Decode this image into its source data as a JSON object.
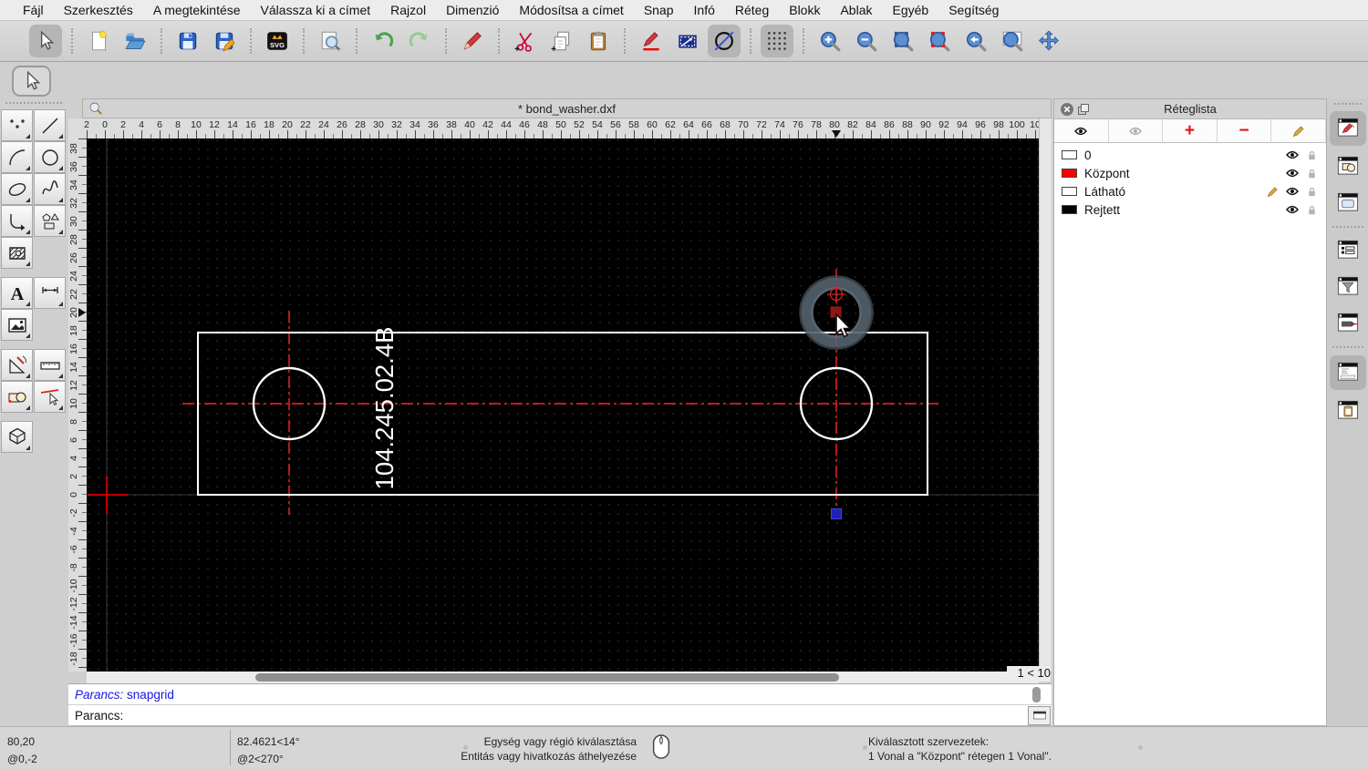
{
  "menu_bar": {
    "items": [
      "Fájl",
      "Szerkesztés",
      "A megtekintése",
      "Válassza ki a címet",
      "Rajzol",
      "Dimenzió",
      "Módosítsa a címet",
      "Snap",
      "Infó",
      "Réteg",
      "Blokk",
      "Ablak",
      "Egyéb",
      "Segítség"
    ]
  },
  "toolbar": {
    "buttons": [
      {
        "name": "select",
        "active": true
      },
      {
        "type": "sep"
      },
      {
        "name": "new-document"
      },
      {
        "name": "open-file"
      },
      {
        "type": "sep"
      },
      {
        "name": "save"
      },
      {
        "name": "save-as"
      },
      {
        "type": "sep"
      },
      {
        "name": "export-svg"
      },
      {
        "type": "sep"
      },
      {
        "name": "print-preview"
      },
      {
        "type": "sep"
      },
      {
        "name": "undo"
      },
      {
        "name": "redo"
      },
      {
        "type": "sep"
      },
      {
        "name": "delete"
      },
      {
        "type": "sep"
      },
      {
        "name": "cut"
      },
      {
        "name": "copy"
      },
      {
        "name": "paste"
      },
      {
        "type": "sep"
      },
      {
        "name": "draw-pen"
      },
      {
        "name": "selection-window"
      },
      {
        "name": "circle-line",
        "active": true
      },
      {
        "type": "sep"
      },
      {
        "name": "snap-grid",
        "active": true
      },
      {
        "type": "sep"
      },
      {
        "name": "zoom-in"
      },
      {
        "name": "zoom-out"
      },
      {
        "name": "zoom-auto"
      },
      {
        "name": "zoom-redraw"
      },
      {
        "name": "zoom-previous"
      },
      {
        "name": "zoom-window"
      },
      {
        "name": "pan"
      }
    ]
  },
  "left_toolbar": {
    "groups": [
      [
        [
          "points",
          "line"
        ],
        [
          "arc",
          "circle"
        ],
        [
          "ellipse",
          "spline"
        ],
        [
          "polyline",
          "polygon"
        ],
        [
          "hatch",
          null
        ]
      ],
      [
        [
          "text",
          "dimension"
        ],
        [
          "image",
          null
        ]
      ],
      [
        [
          "modify",
          "measure"
        ],
        [
          "block",
          "deselect"
        ]
      ],
      [
        [
          "solid",
          null
        ]
      ]
    ]
  },
  "document_window": {
    "title": "* bond_washer.dxf",
    "zoom_indicator": "1 < 10",
    "drawing_label": "104.245.02.4B"
  },
  "rulers": {
    "horizontal": [
      "2",
      "0",
      "2",
      "4",
      "6",
      "8",
      "10",
      "12",
      "14",
      "16",
      "18",
      "20",
      "22",
      "24",
      "26",
      "28",
      "30",
      "32",
      "34",
      "36",
      "38",
      "40",
      "42",
      "44",
      "46",
      "48",
      "50",
      "52",
      "54",
      "56",
      "58",
      "60",
      "62",
      "64",
      "66",
      "68",
      "70",
      "72",
      "74",
      "76",
      "78",
      "80",
      "82",
      "84",
      "86",
      "88",
      "90",
      "92",
      "94",
      "96",
      "98",
      "100",
      "10"
    ],
    "vertical": [
      "38",
      "36",
      "34",
      "32",
      "30",
      "28",
      "26",
      "24",
      "22",
      "20",
      "18",
      "16",
      "14",
      "12",
      "10",
      "8",
      "6",
      "4",
      "2",
      "0",
      "-2",
      "-4",
      "-6",
      "-8",
      "-10",
      "-12",
      "-14",
      "-16",
      "-18"
    ]
  },
  "layer_panel": {
    "title": "Réteglista",
    "toolbar": [
      "show-all-layers",
      "hide-all-layers",
      "add-layer",
      "remove-layer",
      "edit-layer"
    ],
    "layers": [
      {
        "name": "0",
        "color": "#ffffff",
        "editing": false
      },
      {
        "name": "Központ",
        "color": "#ff0000",
        "editing": false
      },
      {
        "name": "Látható",
        "color": "#ffffff",
        "editing": true
      },
      {
        "name": "Rejtett",
        "color": "#000000",
        "editing": false
      }
    ]
  },
  "right_dock": {
    "groups": [
      [
        {
          "name": "layer-list",
          "active": true
        },
        {
          "name": "block-list",
          "active": false
        },
        {
          "name": "library-browser",
          "active": false
        }
      ],
      [
        {
          "name": "entity-list",
          "active": false
        },
        {
          "name": "entity-filter",
          "active": false
        },
        {
          "name": "pen-palette",
          "active": false
        }
      ],
      [
        {
          "name": "command-line",
          "active": true
        },
        {
          "name": "clipboard",
          "active": false
        }
      ]
    ]
  },
  "command": {
    "history_label": "Parancs:",
    "history_command": "snapgrid",
    "prompt_label": "Parancs:",
    "input_value": ""
  },
  "status_bar": {
    "absolute_coord": "80,20",
    "relative_coord": "@0,-2",
    "polar_absolute": "82.4621<14°",
    "polar_relative": "@2<270°",
    "hint_line1": "Egység vagy régió kiválasztása",
    "hint_line2": "Entitás vagy hivatkozás áthelyezése",
    "selection_title": "Kiválasztott szervezetek:",
    "selection_detail": "1 Vonal a \"Központ\" rétegen 1 Vonal\"."
  },
  "colors": {
    "canvas_bg": "#000000",
    "centerline_red": "#ff2222",
    "origin_red": "#d40000",
    "selection_blue": "#2020b8",
    "layer_kozpont_red": "#ff0000"
  }
}
